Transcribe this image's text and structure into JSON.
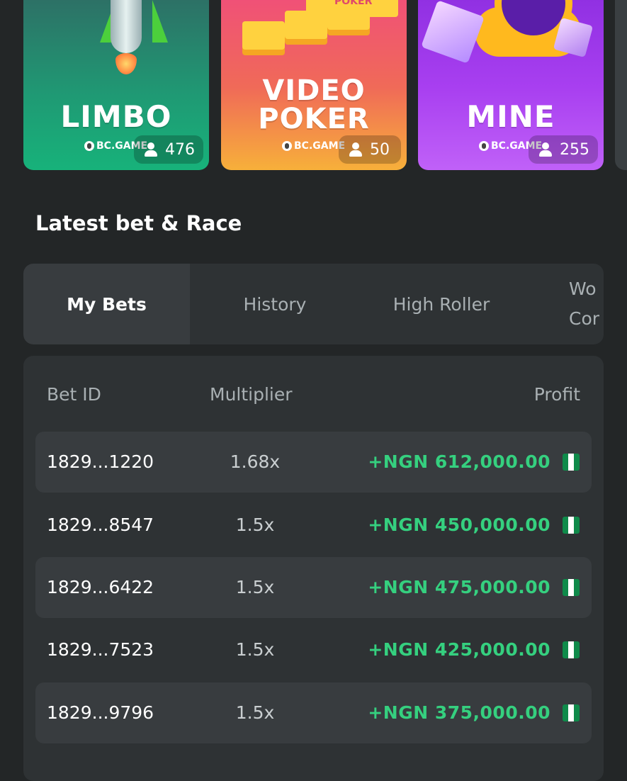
{
  "games": [
    {
      "title": "LIMBO",
      "brand": "BC.GAME",
      "players": "476",
      "color": "#1f9a74"
    },
    {
      "title": "VIDEO POKER",
      "title_line1": "VIDEO",
      "title_line2": "POKER",
      "ribbon": "POKER",
      "brand": "BC.GAME",
      "players": "50",
      "color": "#f06a58"
    },
    {
      "title": "MINE",
      "brand": "BC.GAME",
      "players": "255",
      "color": "#a83ff0"
    }
  ],
  "section": {
    "title": "Latest bet & Race"
  },
  "tabs": [
    {
      "label": "My Bets",
      "active": true
    },
    {
      "label": "History"
    },
    {
      "label": "High Roller"
    },
    {
      "label": "Wo\nCor"
    }
  ],
  "table": {
    "headers": {
      "bet_id": "Bet ID",
      "multiplier": "Multiplier",
      "profit": "Profit"
    },
    "rows": [
      {
        "bet_id": "1829...1220",
        "multiplier": "1.68x",
        "profit": "+NGN 612,000.00",
        "currency_flag": "nigeria-flag-icon"
      },
      {
        "bet_id": "1829...8547",
        "multiplier": "1.5x",
        "profit": "+NGN 450,000.00",
        "currency_flag": "nigeria-flag-icon"
      },
      {
        "bet_id": "1829...6422",
        "multiplier": "1.5x",
        "profit": "+NGN 475,000.00",
        "currency_flag": "nigeria-flag-icon"
      },
      {
        "bet_id": "1829...7523",
        "multiplier": "1.5x",
        "profit": "+NGN 425,000.00",
        "currency_flag": "nigeria-flag-icon"
      },
      {
        "bet_id": "1829...9796",
        "multiplier": "1.5x",
        "profit": "+NGN 375,000.00",
        "currency_flag": "nigeria-flag-icon"
      }
    ]
  },
  "colors": {
    "background": "#232627",
    "panel": "#2e3234",
    "row_highlight": "#383c3f",
    "profit_green": "#35d07f"
  }
}
